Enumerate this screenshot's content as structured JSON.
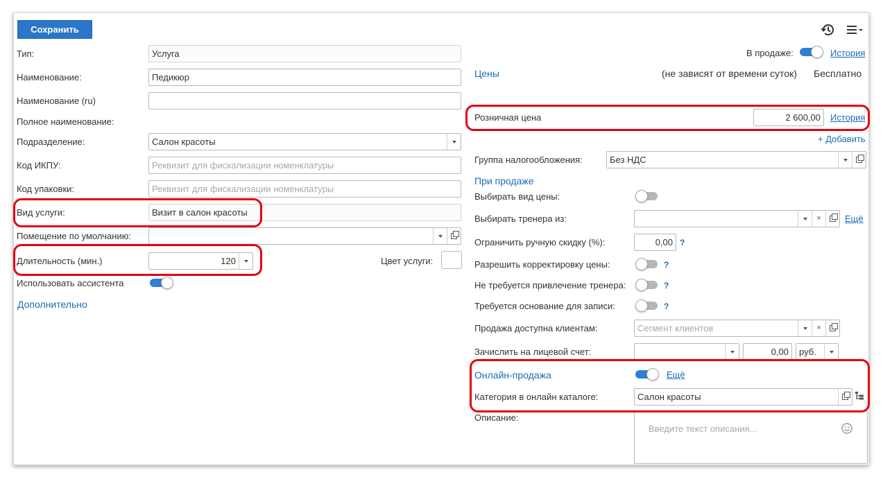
{
  "toolbar": {
    "save_label": "Сохранить"
  },
  "left": {
    "type_label": "Тип:",
    "type_value": "Услуга",
    "name_label": "Наименование:",
    "name_value": "Педикюр",
    "name_ru_label": "Наименование (ru)",
    "name_ru_value": "",
    "full_name_label": "Полное наименование:",
    "department_label": "Подразделение:",
    "department_value": "Салон красоты",
    "ikpu_label": "Код ИКПУ:",
    "ikpu_placeholder": "Реквизит для фискализации номенклатуры",
    "package_label": "Код упаковки:",
    "package_placeholder": "Реквизит для фискализации номенклатуры",
    "service_kind_label": "Вид услуги:",
    "service_kind_value": "Визит в салон красоты",
    "room_label": "Помещение по умолчанию:",
    "room_value": "",
    "duration_label": "Длительность (мин.)",
    "duration_value": "120",
    "color_label": "Цвет услуги:",
    "assistant_label": "Использовать ассистента",
    "assistant_on": true,
    "additional_label": "Дополнительно"
  },
  "right": {
    "on_sale_label": "В продаже:",
    "on_sale_on": true,
    "history_label": "История",
    "prices_title": "Цены",
    "prices_note": "(не зависят от времени суток)",
    "prices_free": "Бесплатно",
    "retail_label": "Розничная цена",
    "retail_value": "2 600,00",
    "retail_history": "История",
    "add_label": "+ Добавить",
    "tax_label": "Группа налогообложения:",
    "tax_value": "Без НДС",
    "on_sale_section": "При продаже",
    "choose_price_label": "Выбирать вид цены:",
    "choose_price_on": false,
    "choose_trainer_label": "Выбирать тренера из:",
    "choose_trainer_value": "",
    "more_label": "Ещё",
    "limit_discount_label": "Ограничить ручную скидку (%):",
    "limit_discount_value": "0,00",
    "allow_price_edit_label": "Разрешить корректировку цены:",
    "allow_price_edit_on": false,
    "no_trainer_label": "Не требуется привлечение тренера:",
    "no_trainer_on": false,
    "require_reason_label": "Требуется основание для записи:",
    "require_reason_on": false,
    "clients_label": "Продажа доступна клиентам:",
    "clients_placeholder": "Сегмент клиентов",
    "account_label": "Зачислить на лицевой счет:",
    "account_value": "",
    "account_amount": "0,00",
    "account_currency": "руб.",
    "online_label": "Онлайн-продажа",
    "online_on": true,
    "online_more": "Ещё",
    "catalog_label": "Категория в онлайн каталоге:",
    "catalog_value": "Салон красоты",
    "description_label": "Описание:",
    "description_placeholder": "Введите текст описания..."
  },
  "help_mark": "?",
  "colors": {
    "accent": "#2a77c9",
    "link": "#1b6cb8",
    "highlight": "#e3000f"
  }
}
